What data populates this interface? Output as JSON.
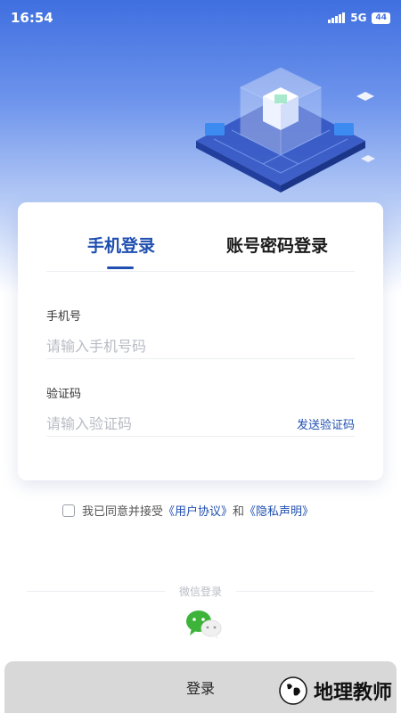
{
  "status_bar": {
    "time": "16:54",
    "network": "5G",
    "battery": "44"
  },
  "tabs": {
    "phone_login": "手机登录",
    "password_login": "账号密码登录"
  },
  "phone_field": {
    "label": "手机号",
    "placeholder": "请输入手机号码"
  },
  "code_field": {
    "label": "验证码",
    "placeholder": "请输入验证码",
    "send_label": "发送验证码"
  },
  "agreement": {
    "prefix": "我已同意并接受",
    "user_agreement": "《用户协议》",
    "and": "和",
    "privacy": "《隐私声明》"
  },
  "wechat": {
    "label": "微信登录",
    "icon": "wechat-icon"
  },
  "login_button": "登录",
  "watermark": "地理教师",
  "colors": {
    "accent": "#1f4fb0",
    "hero_top": "#3f6fe0",
    "wechat_green": "#3db33a"
  }
}
